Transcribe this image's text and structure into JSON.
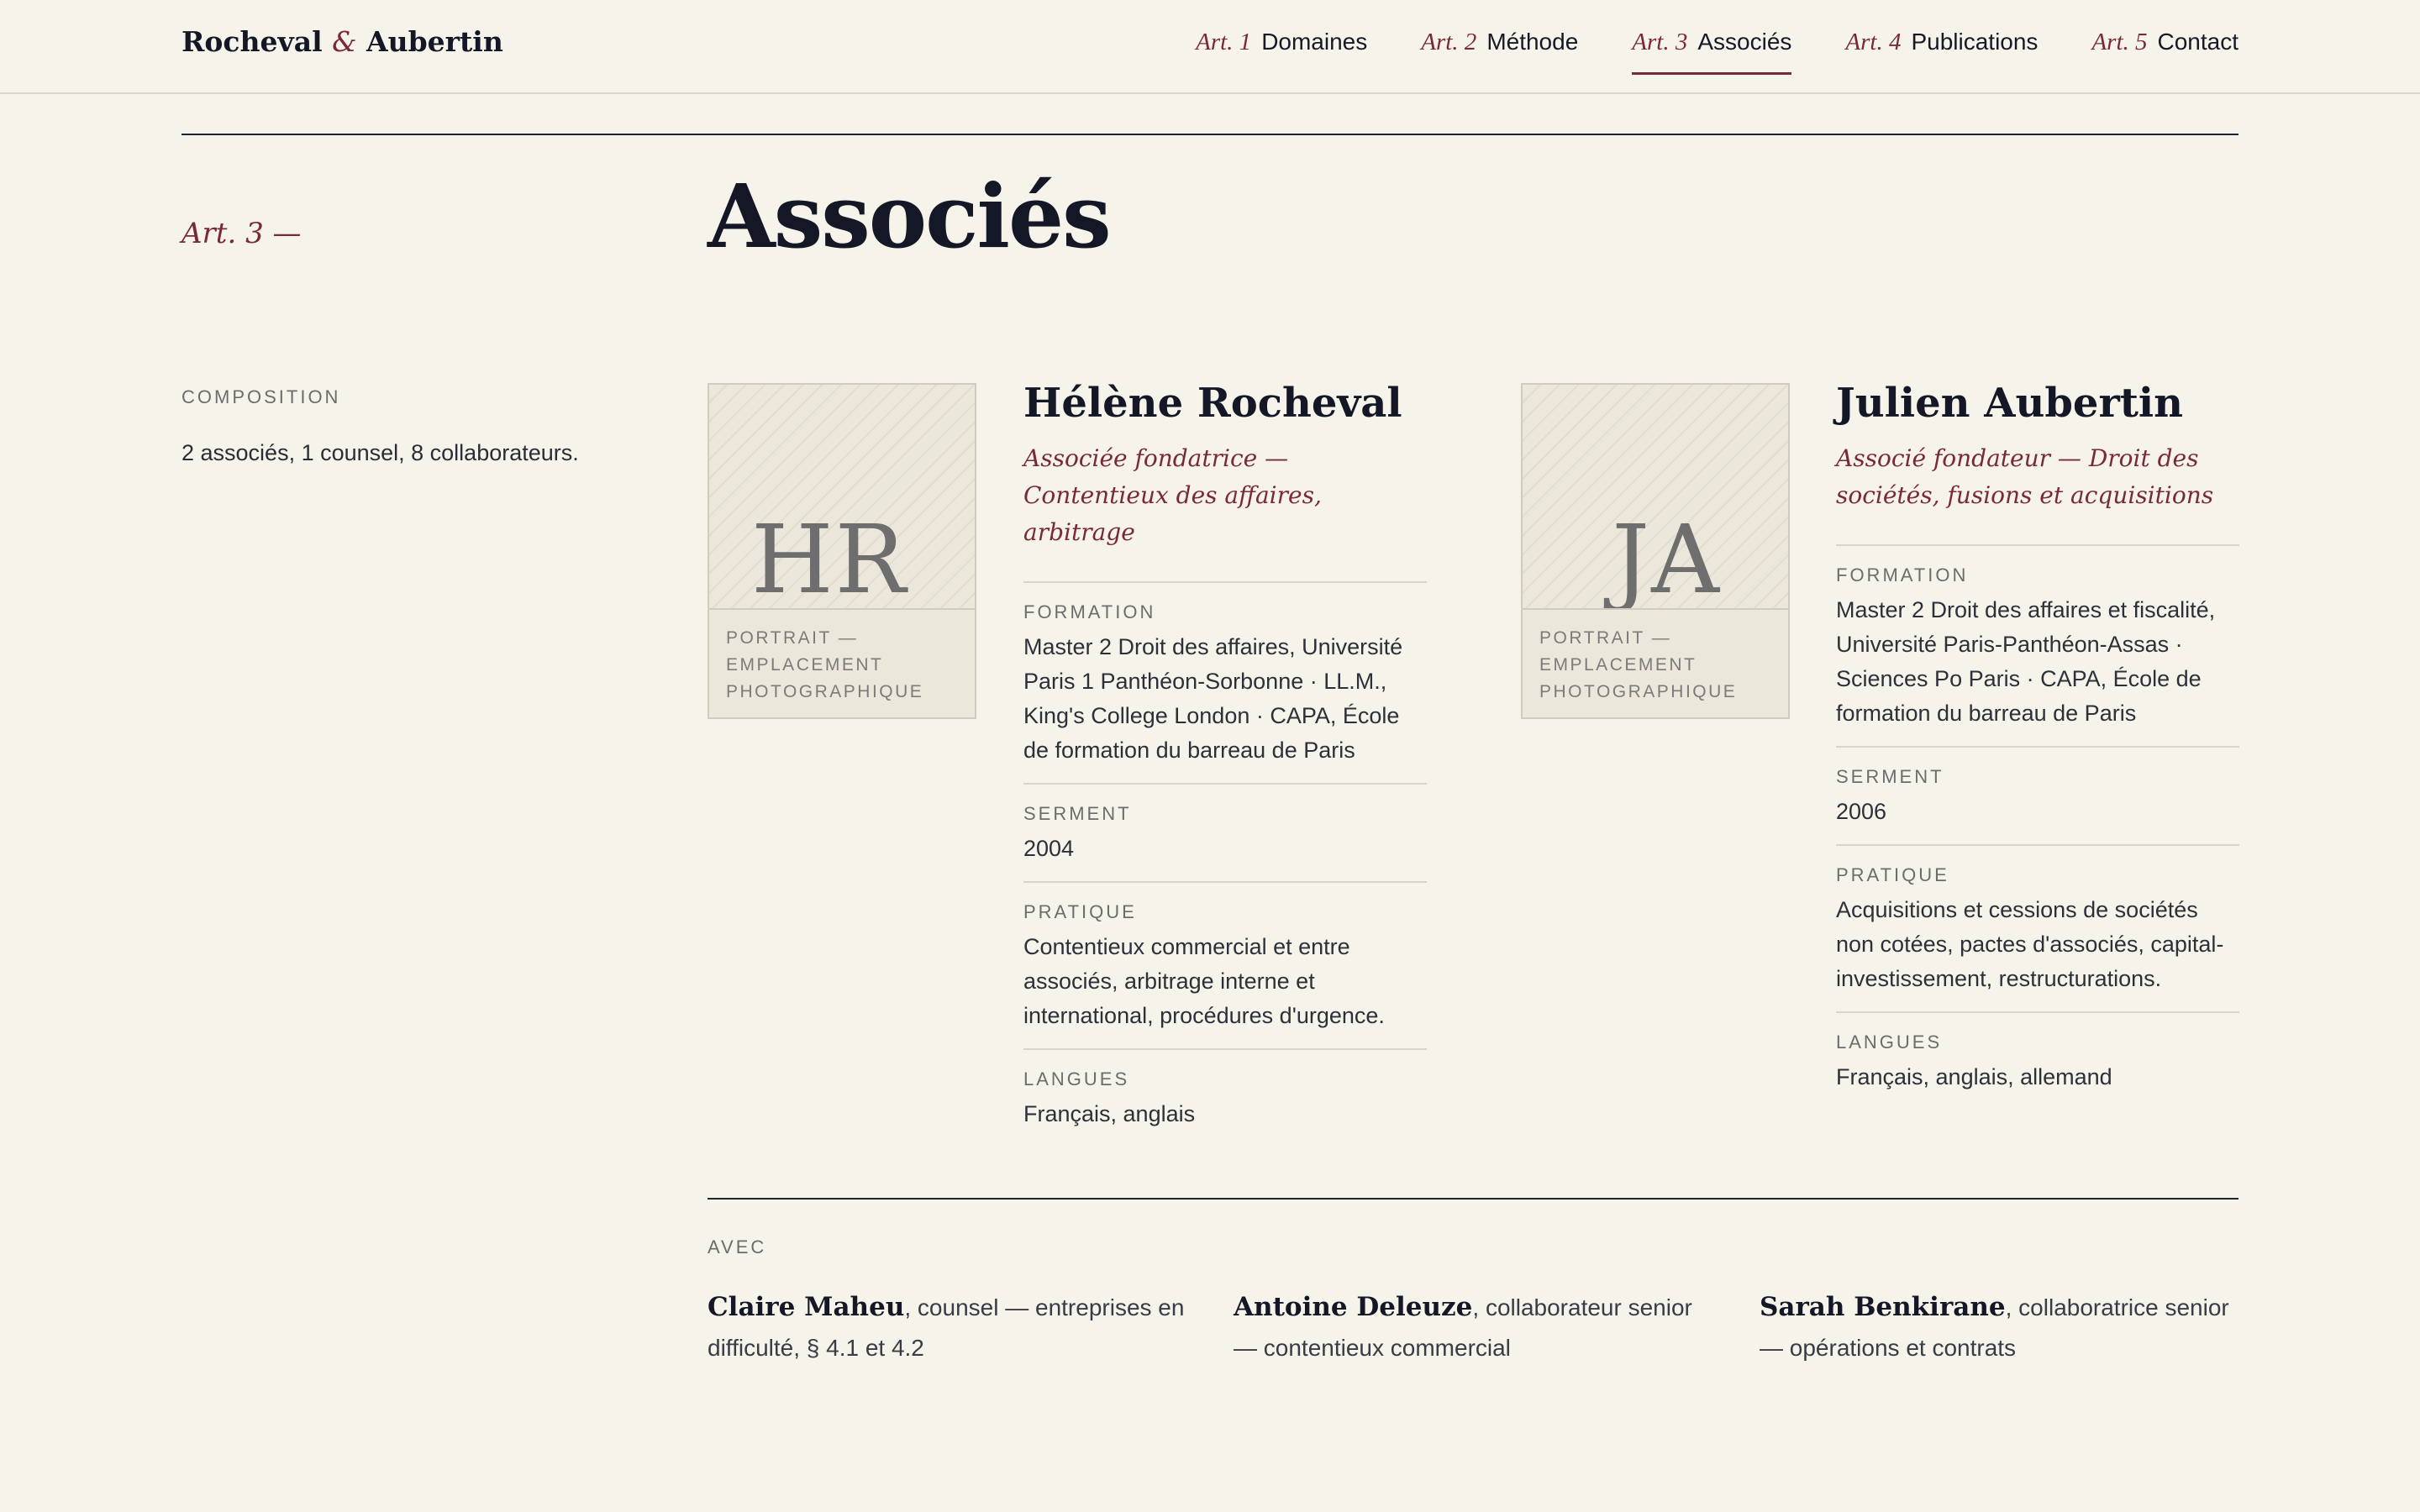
{
  "header": {
    "brand_left": "Rocheval",
    "brand_amp": "&",
    "brand_right": "Aubertin",
    "nav": [
      {
        "art": "Art. 1",
        "label": "Domaines",
        "active": false
      },
      {
        "art": "Art. 2",
        "label": "Méthode",
        "active": false
      },
      {
        "art": "Art. 3",
        "label": "Associés",
        "active": true
      },
      {
        "art": "Art. 4",
        "label": "Publications",
        "active": false
      },
      {
        "art": "Art. 5",
        "label": "Contact",
        "active": false
      }
    ]
  },
  "section": {
    "art_tag": "Art. 3 —",
    "title": "Associés"
  },
  "composition": {
    "label": "Composition",
    "text": "2 associés, 1 counsel, 8 collaborateurs."
  },
  "partners": [
    {
      "initials": "HR",
      "portrait_caption": "Portrait — emplacement photographique",
      "name": "Hélène Rocheval",
      "role": "Associée fondatrice — Contentieux des affaires, arbitrage",
      "fields": [
        {
          "label": "Formation",
          "value": "Master 2 Droit des affaires, Université Paris 1 Panthéon-Sorbonne · LL.M., King's College London · CAPA, École de formation du barreau de Paris"
        },
        {
          "label": "Serment",
          "value": "2004"
        },
        {
          "label": "Pratique",
          "value": "Contentieux commercial et entre associés, arbitrage interne et international, procédures d'urgence."
        },
        {
          "label": "Langues",
          "value": "Français, anglais"
        }
      ]
    },
    {
      "initials": "JA",
      "portrait_caption": "Portrait — emplacement photographique",
      "name": "Julien Aubertin",
      "role": "Associé fondateur — Droit des sociétés, fusions et acquisitions",
      "fields": [
        {
          "label": "Formation",
          "value": "Master 2 Droit des affaires et fiscalité, Université Paris-Panthéon-Assas · Sciences Po Paris · CAPA, École de formation du barreau de Paris"
        },
        {
          "label": "Serment",
          "value": "2006"
        },
        {
          "label": "Pratique",
          "value": "Acquisitions et cessions de sociétés non cotées, pactes d'associés, capital-investissement, restructurations."
        },
        {
          "label": "Langues",
          "value": "Français, anglais, allemand"
        }
      ]
    }
  ],
  "avec": {
    "label": "Avec",
    "people": [
      {
        "name": "Claire Maheu",
        "desc": ", counsel — entreprises en difficulté, § 4.1 et 4.2"
      },
      {
        "name": "Antoine Deleuze",
        "desc": ", collaborateur senior — contentieux commercial"
      },
      {
        "name": "Sarah Benkirane",
        "desc": ", collaboratrice senior — opérations et contrats"
      }
    ]
  },
  "colors": {
    "background": "#f6f4ea",
    "accent": "#7a2a35",
    "ink": "#141826"
  }
}
